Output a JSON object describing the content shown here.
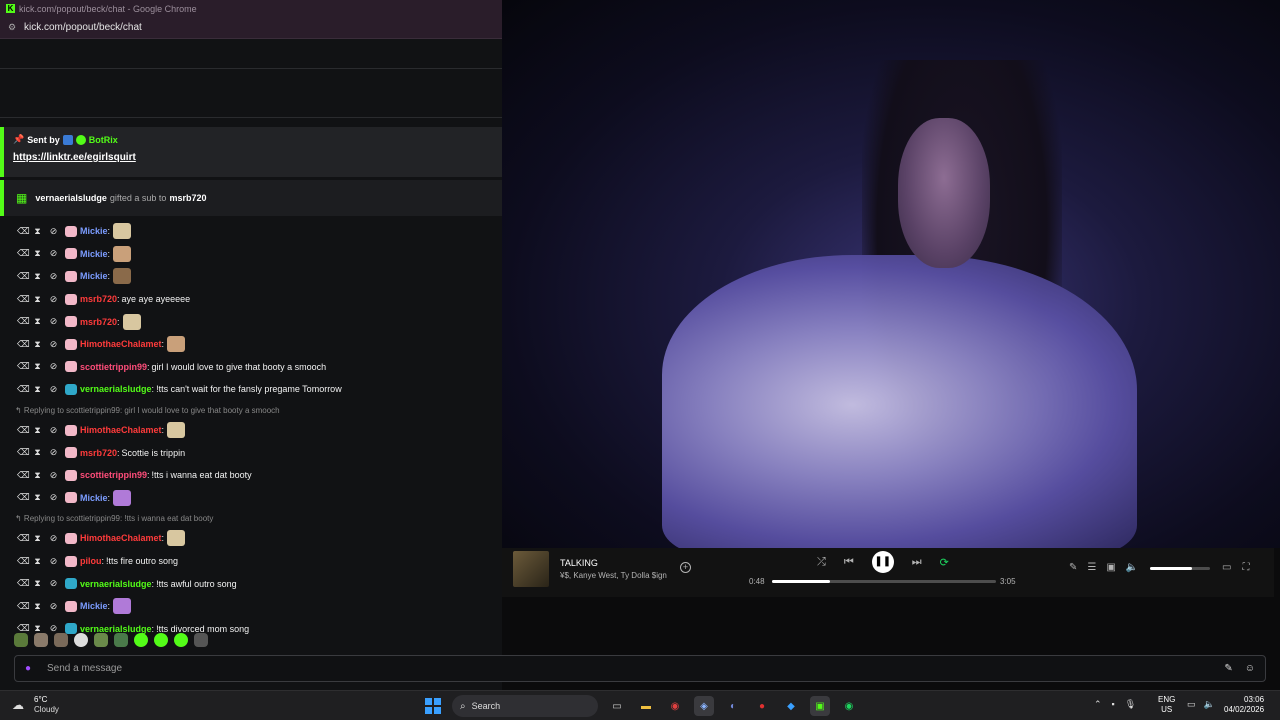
{
  "window": {
    "title": "kick.com/popout/beck/chat - Google Chrome",
    "url": "kick.com/popout/beck/chat"
  },
  "pinned": {
    "sent_by_label": "Sent by",
    "bot_name": "BotRix",
    "link": "https://linktr.ee/egirlsquirt"
  },
  "gift": {
    "gifter": "vernaerialsludge",
    "middle": "gifted a sub to",
    "recipient": "msrb720"
  },
  "messages": [
    {
      "user": "Mickie",
      "color": "#7b9cff",
      "text": ""
    },
    {
      "user": "Mickie",
      "color": "#7b9cff",
      "text": ""
    },
    {
      "user": "Mickie",
      "color": "#7b9cff",
      "text": ""
    },
    {
      "user": "msrb720",
      "color": "#ff3b3b",
      "text": "aye aye ayeeeee"
    },
    {
      "user": "msrb720",
      "color": "#ff3b3b",
      "text": ""
    },
    {
      "user": "HimothaeChalamet",
      "color": "#ff3b3b",
      "text": ""
    },
    {
      "user": "scottietrippin99",
      "color": "#ff4d7a",
      "text": "girl I would love to give that booty a smooch"
    },
    {
      "user": "vernaerialsludge",
      "color": "#53fc18",
      "text": "!tts can't wait for the fansly pregame Tomorrow"
    },
    {
      "user": "HimothaeChalamet",
      "color": "#ff3b3b",
      "text": "",
      "reply": "Replying to scottietrippin99: girl I would love to give that booty a smooch"
    },
    {
      "user": "msrb720",
      "color": "#ff3b3b",
      "text": "Scottie is trippin"
    },
    {
      "user": "scottietrippin99",
      "color": "#ff4d7a",
      "text": "!tts i wanna eat dat booty"
    },
    {
      "user": "Mickie",
      "color": "#7b9cff",
      "text": ""
    },
    {
      "user": "HimothaeChalamet",
      "color": "#ff3b3b",
      "text": "",
      "reply": "Replying to scottietrippin99: !tts i wanna eat dat booty"
    },
    {
      "user": "pilou",
      "color": "#ff3b3b",
      "text": "!tts fire outro song"
    },
    {
      "user": "vernaerialsludge",
      "color": "#53fc18",
      "text": "!tts awful outro song"
    },
    {
      "user": "Mickie",
      "color": "#7b9cff",
      "text": ""
    },
    {
      "user": "vernaerialsludge",
      "color": "#53fc18",
      "text": "!tts divorced mom song"
    }
  ],
  "input": {
    "placeholder": "Send a message"
  },
  "player": {
    "track": "TALKING",
    "artists": "¥$, Kanye West, Ty Dolla $ign",
    "elapsed": "0:48",
    "duration": "3:05",
    "progress": 0.26,
    "volume": 0.7
  },
  "taskbar": {
    "temp": "6°C",
    "condition": "Cloudy",
    "search_label": "Search",
    "lang1": "ENG",
    "lang2": "US",
    "time": "03:06",
    "date": "04/02/2026"
  },
  "colors": {
    "kick_green": "#53fc18",
    "spotify_green": "#1ed760"
  }
}
